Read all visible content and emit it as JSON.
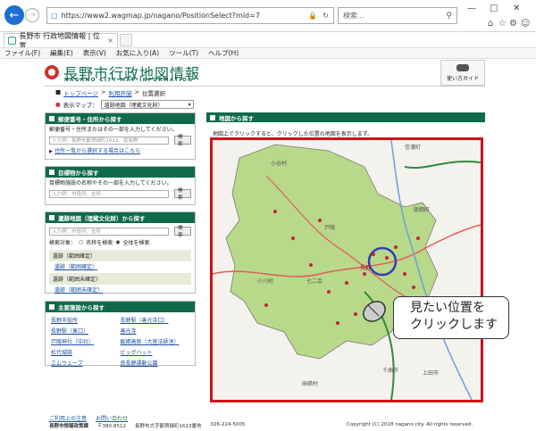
{
  "browser": {
    "url": "https://www2.wagmap.jp/nagano/PositionSelect?mid=7",
    "search_placeholder": "検索...",
    "tab_title": "長野市 行政地図情報 | 位置...",
    "menu": [
      "ファイル(F)",
      "編集(E)",
      "表示(V)",
      "お気に入り(A)",
      "ツール(T)",
      "ヘルプ(H)"
    ]
  },
  "header": {
    "logo_title": "長野市行政地図情報",
    "logo_subtitle": "NAGANO CITY MAP INFORMATION",
    "guide_label": "使い方ガイド"
  },
  "breadcrumb": {
    "items": [
      "トップページ",
      "利用許諾",
      "位置選択"
    ]
  },
  "map_select": {
    "label": "表示マップ：",
    "value": "遺跡地図（埋蔵文化財）"
  },
  "panels": {
    "postal": {
      "title": "郵便番号・住所から探す",
      "desc": "郵便番号・住所またはその一部を入力してください。",
      "placeholder": "入力例：長野市鶴賀緑町1613、南長野",
      "button": "検索",
      "link": "住所一覧から選択する場合はこちら"
    },
    "landmark": {
      "title": "目標物から探す",
      "desc": "目標物施設の名称やその一部を入力してください。",
      "placeholder": "入力例：市役所、支所",
      "button": "検索"
    },
    "ruins": {
      "title": "遺跡地図（埋蔵文化財）から探す",
      "placeholder": "入力例：市役所、支所",
      "button": "検索",
      "target_label": "検索対象：",
      "option_name": "名称を検索",
      "option_all": "全体を検索",
      "groups": [
        {
          "label": "遺跡（範囲確定）",
          "sub": "遺跡（範囲確定）"
        },
        {
          "label": "遺跡（範囲未確定）",
          "sub": "遺跡（範囲未確定）"
        }
      ]
    },
    "facilities": {
      "title": "主要施設から探す",
      "items": [
        "長野市役所",
        "長野駅（善光寺口）",
        "長野駅（東口）",
        "善光寺",
        "戸隠神社（中社）",
        "飯綱高原（大座法師池）",
        "松代城跡",
        "ビッグハット",
        "エムウェーブ",
        "南長野運動公園"
      ]
    }
  },
  "main": {
    "title": "地図から探す",
    "hint": "地図上でクリックすると、クリックした位置の地図を表示します。",
    "map_labels": [
      "小谷村",
      "信濃町",
      "飯綱町",
      "小川村",
      "長野",
      "七二会",
      "戸隠",
      "上田市",
      "千曲市",
      "麻績村"
    ],
    "callout": [
      "見たい位置を",
      "クリックします"
    ]
  },
  "footer": {
    "links": [
      "ご利用上の注意",
      "お問い合わせ"
    ],
    "org": "長野市情報政策課",
    "postal": "〒380-8512",
    "address": "長野市大字鶴賀緑町1613番地",
    "phone": "026-224-5005",
    "copyright": "Copyright (C) 2018 nagano city. All rights reserved."
  },
  "colors": {
    "brand_green": "#0e6a4b",
    "highlight_red": "#d0121a",
    "map_green": "#b8d88a"
  }
}
